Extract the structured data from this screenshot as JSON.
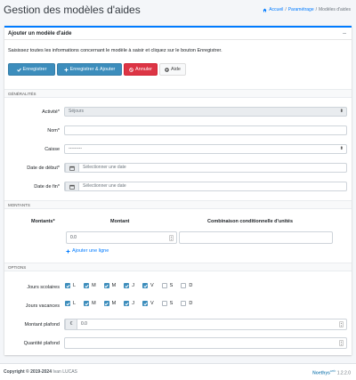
{
  "header": {
    "title": "Gestion des modèles d'aides",
    "breadcrumb": [
      "Accueil",
      "Paramétrage",
      "Modèles d'aides"
    ]
  },
  "card": {
    "title": "Ajouter un modèle d'aide",
    "collapse": "–",
    "intro": "Saisissez toutes les informations concernant le modèle à saisir et cliquez sur le bouton Enregistrer."
  },
  "buttons": {
    "save": "Enregistrer",
    "save_add": "Enregistrer & Ajouter",
    "cancel": "Annuler",
    "help": "Aide"
  },
  "sections": {
    "general": "GÉNÉRALITÉS",
    "amounts": "MONTANTS",
    "options": "OPTIONS"
  },
  "fields": {
    "activite_label": "Activité*",
    "activite_value": "Séjours",
    "nom_label": "Nom*",
    "caisse_label": "Caisse",
    "caisse_value": "---------",
    "date_debut_label": "Date de début*",
    "date_fin_label": "Date de fin*",
    "date_placeholder": "Sélectionner une date"
  },
  "montants": {
    "row_label": "Montants*",
    "col_montant": "Montant",
    "col_combinaison": "Combinaison conditionnelle d'unités",
    "montant_value": "0.0",
    "add_line": "Ajouter une ligne"
  },
  "options": {
    "jours_scolaires_label": "Jours scolaires",
    "jours_vacances_label": "Jours vacances",
    "days": [
      "L",
      "M",
      "M",
      "J",
      "V",
      "S",
      "D"
    ],
    "scolaires_checked": [
      true,
      true,
      true,
      true,
      true,
      false,
      false
    ],
    "vacances_checked": [
      true,
      true,
      true,
      true,
      true,
      false,
      false
    ],
    "montant_plafond_label": "Montant plafond",
    "currency": "€",
    "montant_plafond_value": "0.0",
    "quantite_plafond_label": "Quantité plafond"
  },
  "footer": {
    "copyright_prefix": "Copyright © 2019-2024",
    "author": "Ivan LUCAS",
    "app_name": "Noethys",
    "app_suffix": "web",
    "version": "1.2.2.0"
  },
  "colors": {
    "primary": "#3c8dbc",
    "danger": "#dc3545",
    "link": "#007bff"
  }
}
